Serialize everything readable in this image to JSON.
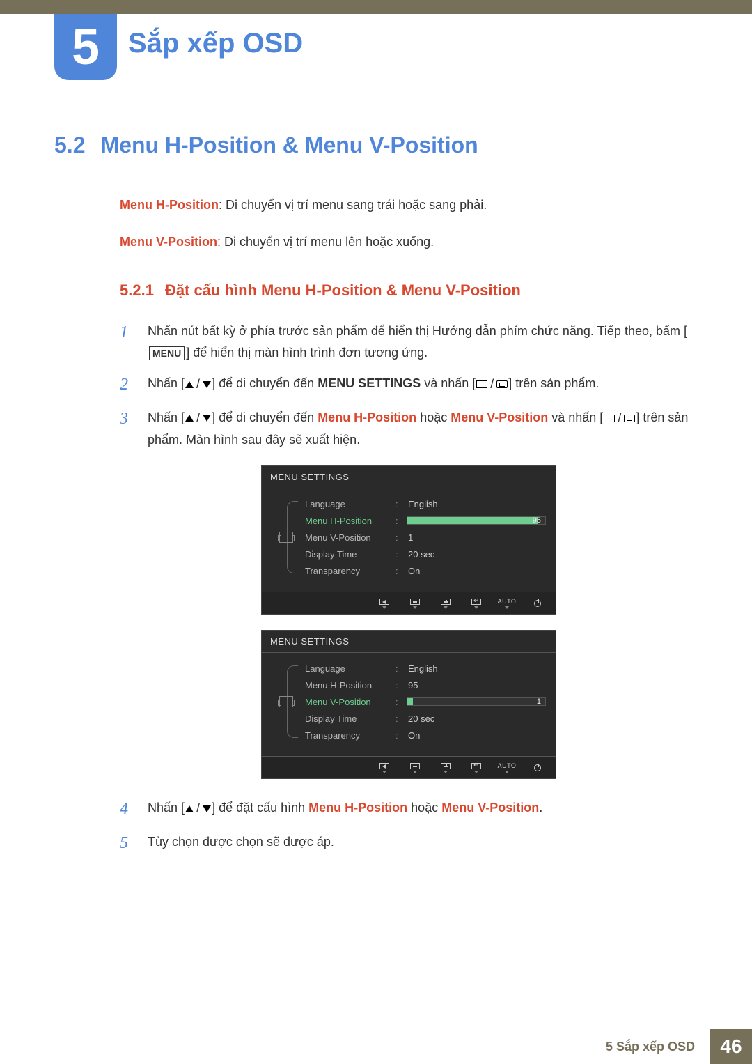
{
  "chapter": {
    "number": "5",
    "title": "Sắp xếp OSD"
  },
  "section": {
    "number": "5.2",
    "title": "Menu H-Position & Menu V-Position"
  },
  "descriptions": [
    {
      "term": "Menu H-Position",
      "text": ": Di chuyển vị trí menu sang trái hoặc sang phải."
    },
    {
      "term": "Menu V-Position",
      "text": ": Di chuyển vị trí menu lên hoặc xuống."
    }
  ],
  "subsection": {
    "number": "5.2.1",
    "title": "Đặt cấu hình Menu H-Position & Menu V-Position"
  },
  "steps": {
    "s1": {
      "num": "1",
      "pre": "Nhấn nút bất kỳ ở phía trước sản phẩm để hiển thị Hướng dẫn phím chức năng. Tiếp theo, bấm [",
      "menu": "MENU",
      "post": "] để hiển thị màn hình trình đơn tương ứng."
    },
    "s2": {
      "num": "2",
      "pre": "Nhấn [",
      "mid": "] để di chuyển đến ",
      "target": "MENU SETTINGS",
      "post1": " và nhấn [",
      "post2": "] trên sản phẩm."
    },
    "s3": {
      "num": "3",
      "pre": "Nhấn [",
      "mid": "] để di chuyển đến ",
      "t1": "Menu H-Position",
      "or": " hoặc ",
      "t2": "Menu V-Position",
      "post1": " và nhấn [",
      "post2": "] trên sản phẩm. Màn hình sau đây sẽ xuất hiện."
    },
    "s4": {
      "num": "4",
      "pre": "Nhấn [",
      "mid": "] để đặt cấu hình ",
      "t1": "Menu H-Position",
      "or": " hoặc ",
      "t2": "Menu V-Position",
      "post": "."
    },
    "s5": {
      "num": "5",
      "text": "Tùy chọn được chọn sẽ được áp."
    }
  },
  "osd": {
    "header": "MENU SETTINGS",
    "rows": {
      "language": {
        "label": "Language",
        "value": "English"
      },
      "hpos": {
        "label": "Menu H-Position",
        "value": "95"
      },
      "vpos": {
        "label": "Menu V-Position",
        "value": "1"
      },
      "dtime": {
        "label": "Display Time",
        "value": "20 sec"
      },
      "transp": {
        "label": "Transparency",
        "value": "On"
      }
    },
    "footer": {
      "auto": "AUTO"
    },
    "hpos_fill_pct": "95%",
    "vpos_fill_pct": "4%"
  },
  "footer": {
    "left": "5 Sắp xếp OSD",
    "page": "46"
  }
}
